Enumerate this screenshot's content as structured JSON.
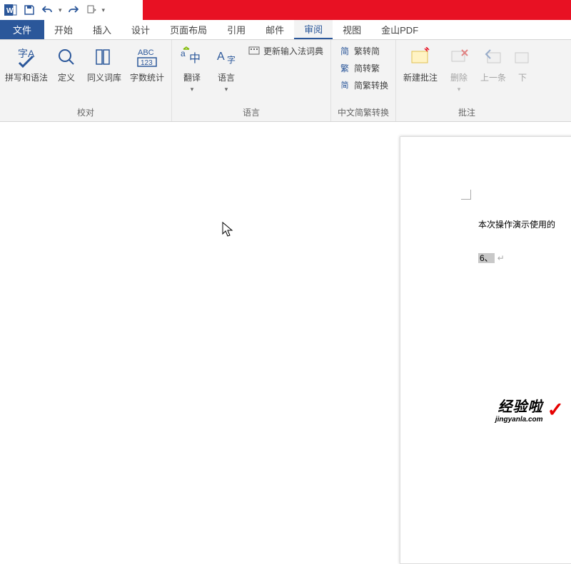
{
  "qat": {
    "save": "保存",
    "undo": "撤销",
    "redo": "重做",
    "touch": "触摸模式"
  },
  "tabs": {
    "file": "文件",
    "home": "开始",
    "insert": "插入",
    "design": "设计",
    "layout": "页面布局",
    "references": "引用",
    "mailings": "邮件",
    "review": "审阅",
    "view": "视图",
    "wps": "金山PDF"
  },
  "ribbon": {
    "proofing": {
      "label": "校对",
      "spelling": "拼写和语法",
      "define": "定义",
      "thesaurus": "同义词库",
      "wordcount": "字数统计"
    },
    "language": {
      "label": "语言",
      "translate": "翻译",
      "language": "语言",
      "update_ime": "更新输入法词典"
    },
    "chinese": {
      "label": "中文简繁转换",
      "s2t": "繁转简",
      "t2s": "简转繁",
      "convert": "简繁转换"
    },
    "comments": {
      "label": "批注",
      "new": "新建批注",
      "delete": "删除",
      "prev": "上一条",
      "next": "下"
    }
  },
  "doc": {
    "line1": "本次操作演示使用的",
    "line2_hl": "6、",
    "line2_ret": "↵"
  },
  "watermark": {
    "line1": "经验啦",
    "line2": "jingyanla.com",
    "check": "✓"
  }
}
